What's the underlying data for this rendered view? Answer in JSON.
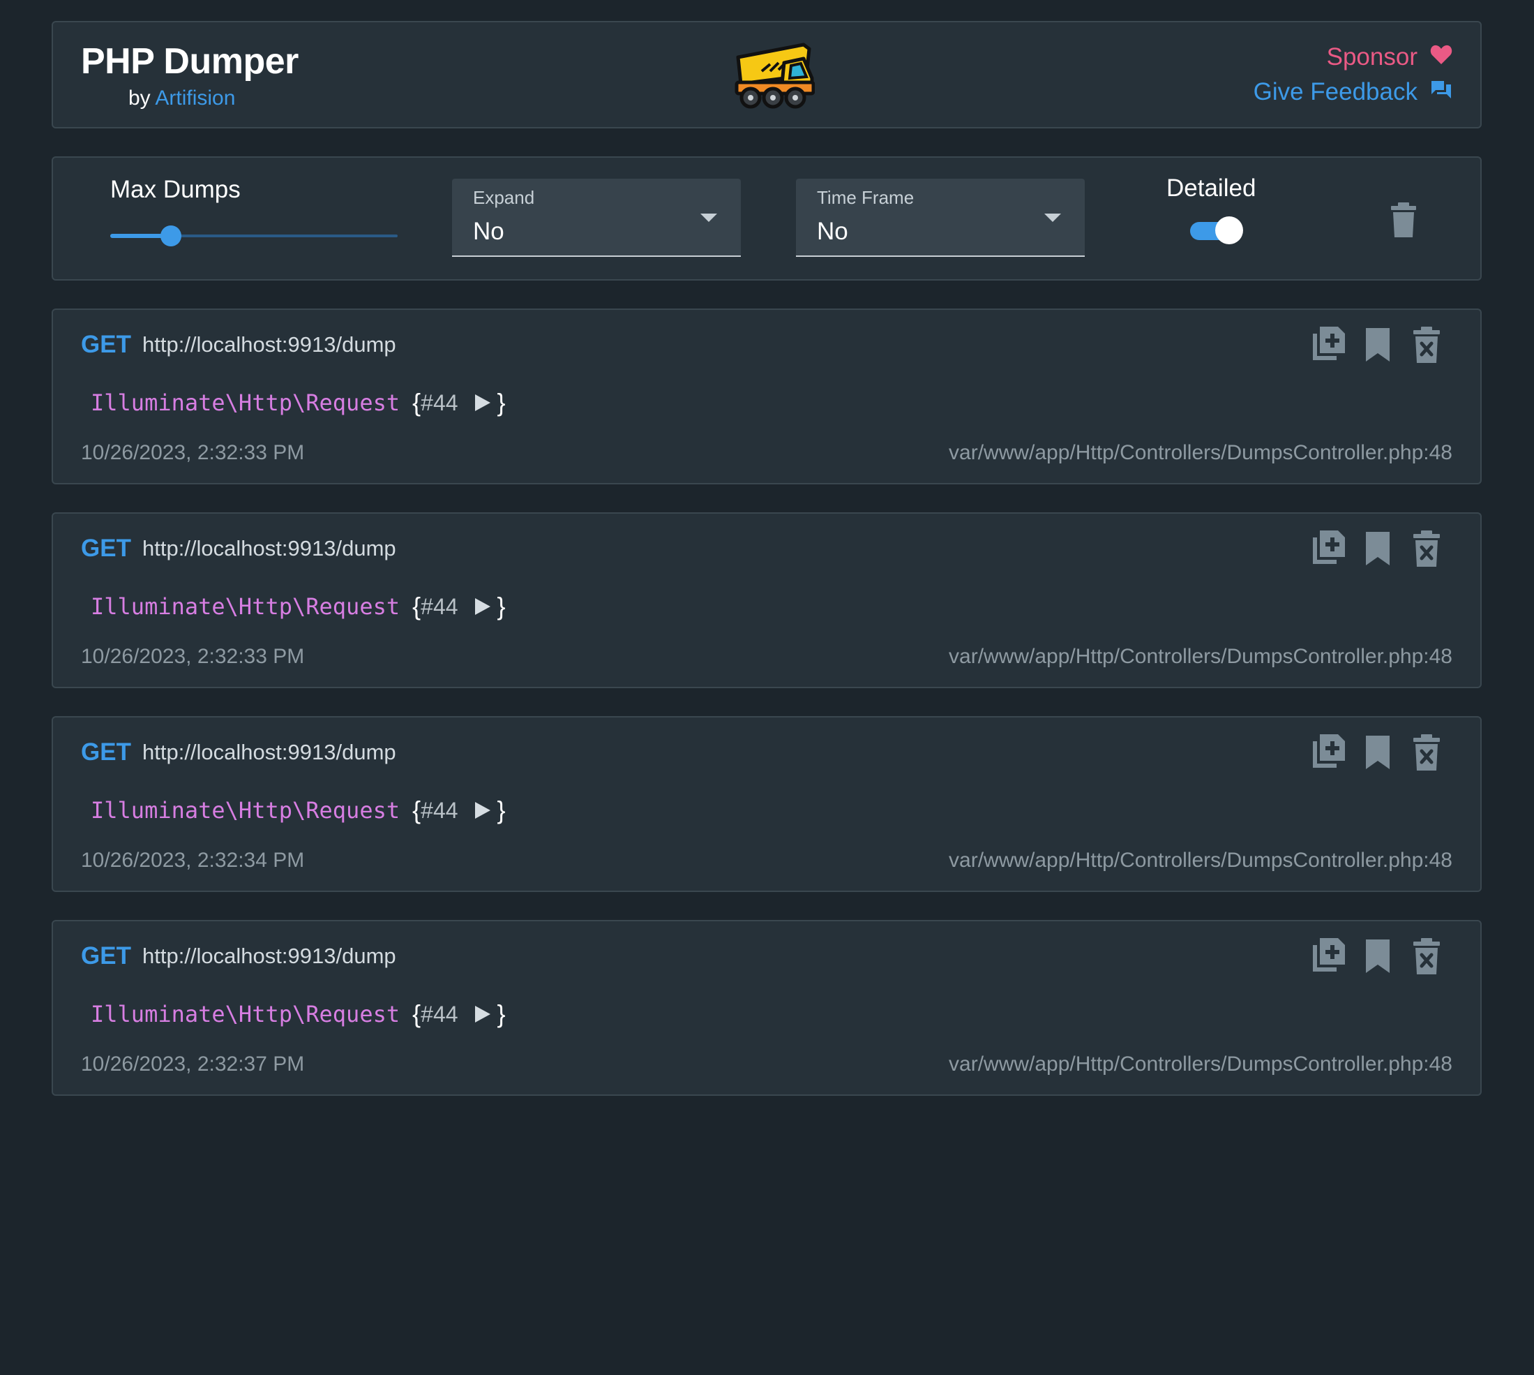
{
  "header": {
    "title": "PHP Dumper",
    "by_prefix": "by",
    "author": "Artifision",
    "sponsor_label": "Sponsor",
    "feedback_label": "Give Feedback",
    "logo_icon": "dump-truck-icon"
  },
  "toolbar": {
    "max_dumps_label": "Max Dumps",
    "max_dumps_fraction": 0.21,
    "expand": {
      "label": "Expand",
      "value": "No"
    },
    "time_frame": {
      "label": "Time Frame",
      "value": "No"
    },
    "detailed_label": "Detailed",
    "detailed_on": true,
    "clear_icon": "trash-icon"
  },
  "colors": {
    "accent": "#3d9ae8",
    "sponsor": "#ea5a85",
    "class_name": "#d77ee2",
    "background": "#1c252c",
    "card": "#263139"
  },
  "dumps": [
    {
      "method": "GET",
      "url": "http://localhost:9913/dump",
      "class_name": "Illuminate\\Http\\Request",
      "open_brace": "{",
      "ref": "#44",
      "close_brace": "}",
      "time": "10/26/2023, 2:32:33 PM",
      "file": "var/www/app/Http/Controllers/DumpsController.php:48"
    },
    {
      "method": "GET",
      "url": "http://localhost:9913/dump",
      "class_name": "Illuminate\\Http\\Request",
      "open_brace": "{",
      "ref": "#44",
      "close_brace": "}",
      "time": "10/26/2023, 2:32:33 PM",
      "file": "var/www/app/Http/Controllers/DumpsController.php:48"
    },
    {
      "method": "GET",
      "url": "http://localhost:9913/dump",
      "class_name": "Illuminate\\Http\\Request",
      "open_brace": "{",
      "ref": "#44",
      "close_brace": "}",
      "time": "10/26/2023, 2:32:34 PM",
      "file": "var/www/app/Http/Controllers/DumpsController.php:48"
    },
    {
      "method": "GET",
      "url": "http://localhost:9913/dump",
      "class_name": "Illuminate\\Http\\Request",
      "open_brace": "{",
      "ref": "#44",
      "close_brace": "}",
      "time": "10/26/2023, 2:32:37 PM",
      "file": "var/www/app/Http/Controllers/DumpsController.php:48"
    }
  ]
}
